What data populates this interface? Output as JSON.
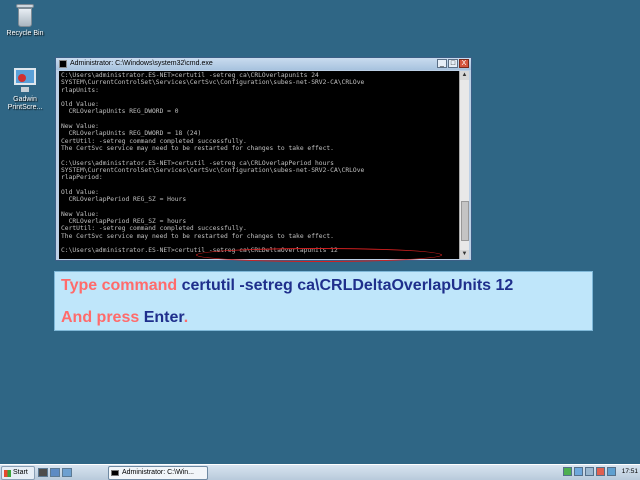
{
  "desktop": {
    "icons": [
      {
        "label": "Recycle Bin"
      },
      {
        "label_line1": "Gadwin",
        "label_line2": "PrintScre..."
      }
    ]
  },
  "cmd_window": {
    "title": "Administrator: C:\\Windows\\system32\\cmd.exe",
    "lines": [
      "C:\\Users\\administrator.ES-NET>certutil -setreg ca\\CRLOverlapunits 24",
      "SYSTEM\\CurrentControlSet\\Services\\CertSvc\\Configuration\\subes-net-SRV2-CA\\CRLOve",
      "rlapUnits:",
      "",
      "Old Value:",
      "  CRLOverlapUnits REG_DWORD = 0",
      "",
      "New Value:",
      "  CRLOverlapUnits REG_DWORD = 18 (24)",
      "CertUtil: -setreg command completed successfully.",
      "The CertSvc service may need to be restarted for changes to take effect.",
      "",
      "C:\\Users\\administrator.ES-NET>certutil -setreg ca\\CRLOverlapPeriod hours",
      "SYSTEM\\CurrentControlSet\\Services\\CertSvc\\Configuration\\subes-net-SRV2-CA\\CRLOve",
      "rlapPeriod:",
      "",
      "Old Value:",
      "  CRLOverlapPeriod REG_SZ = Hours",
      "",
      "New Value:",
      "  CRLOverlapPeriod REG_SZ = hours",
      "CertUtil: -setreg command completed successfully.",
      "The CertSvc service may need to be restarted for changes to take effect.",
      "",
      "C:\\Users\\administrator.ES-NET>certutil -setreg ca\\CRLDeltaOverlapunits 12"
    ],
    "buttons": {
      "minimize": "_",
      "maximize": "□",
      "close": "X"
    }
  },
  "instruction": {
    "line1_prefix": "Type command ",
    "line1_command": "certutil -setreg ca\\CRLDeltaOverlapUnits 12",
    "line2_prefix": "And press ",
    "line2_key": "Enter",
    "line2_suffix": "."
  },
  "taskbar": {
    "start_label": "Start",
    "task_label": "Administrator: C:\\Win...",
    "clock": "17:51"
  },
  "colors": {
    "desktop": "#2f6685",
    "instruction_bg": "#bfe6fa",
    "instruction_red": "#ff6b6b",
    "instruction_blue": "#1f2f8c"
  }
}
